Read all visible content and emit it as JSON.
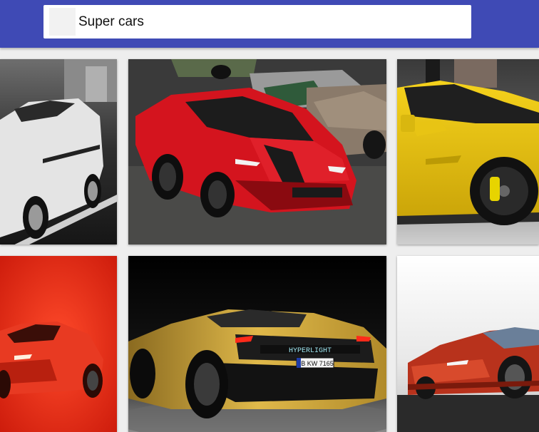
{
  "search": {
    "value": "Super cars",
    "placeholder": ""
  },
  "colors": {
    "header": "#3f4ab5",
    "page_background": "#eeeeee"
  },
  "results": [
    {
      "image": "white-sports-car-monochrome"
    },
    {
      "image": "red-supercar-garage"
    },
    {
      "image": "yellow-supercar-side"
    },
    {
      "image": "orange-concept-car-red-backdrop"
    },
    {
      "image": "gold-hypercar-front",
      "plate_text": "B KW 7165",
      "badge_text": "HYPERLIGHT"
    },
    {
      "image": "red-concept-car-white-backdrop"
    }
  ]
}
